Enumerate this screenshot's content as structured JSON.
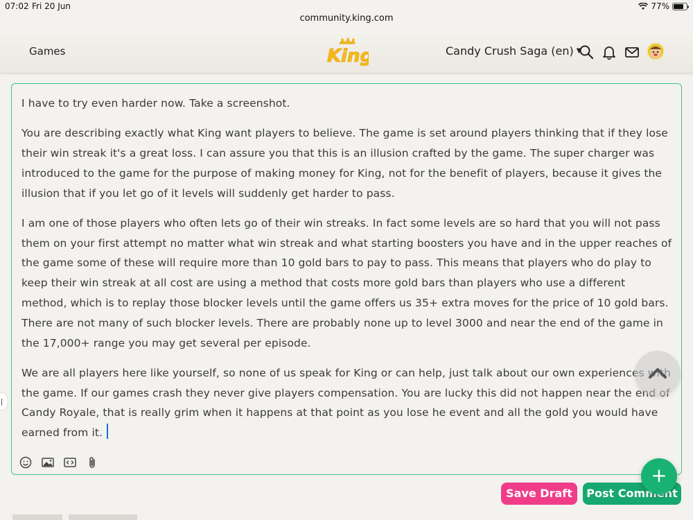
{
  "status_bar": {
    "time": "07:02",
    "date": "Fri 20 Jun",
    "battery": "77%",
    "battery_level": 0.77
  },
  "browser": {
    "url": "community.king.com"
  },
  "header": {
    "nav_games": "Games",
    "logo_text": "King",
    "game_selector": "Candy Crush Saga (en)",
    "icons": [
      "search-icon",
      "bell-icon",
      "mail-icon",
      "avatar"
    ]
  },
  "editor": {
    "paragraphs": [
      "I have to try even harder now. Take a screenshot.",
      "You are describing exactly what King want players to believe. The game is set around players thinking that if they lose their win streak it's a great loss. I can assure you that this is an illusion crafted by the game. The super charger was introduced to the game for the purpose of making money for King, not for the benefit of players, because it gives the illusion that if you let go of it levels will suddenly get harder to pass.",
      "I am one of those players who often lets go of their win streaks. In fact some levels are so hard that you will not pass them on your first attempt no matter what win streak and what starting boosters you have and in the upper reaches of the game some of these will require more than 10 gold bars to pay to pass. This means that players who do play to keep their win streak at all cost are using a method that costs more gold bars than players who use a different method, which is to replay those blocker levels until the game offers us 35+ extra moves for the price of 10 gold bars. There are not many of such blocker levels. There are probably none up to level 3000 and near the end of the game in the 17,000+ range you may get several per episode.",
      "We are all players here like yourself, so none of us speak for King or can help, just talk about our own experiences with the game. If our games crash they never give players compensation. You are lucky this did not happen near the end of Candy Royale, that is really grim when it happens at that point as you lose he event and all the gold you would have earned from it."
    ],
    "toolbar_icons": [
      "emoji-icon",
      "image-icon",
      "code-icon",
      "attachment-icon"
    ]
  },
  "actions": {
    "save_draft": "Save Draft",
    "post_comment": "Post Comment",
    "fab": "+"
  },
  "colors": {
    "accent_green": "#16a86f",
    "draft_pink": "#f03d8a",
    "editor_border": "#3ec28f",
    "logo_yellow": "#f5b91a"
  }
}
